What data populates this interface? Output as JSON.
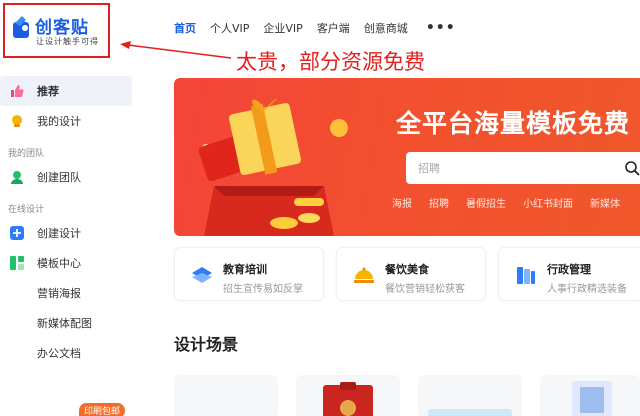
{
  "logo": {
    "name": "创客贴",
    "slogan": "让设计触手可得"
  },
  "annotation": {
    "text": "太贵，部分资源免费"
  },
  "topnav": {
    "items": [
      "首页",
      "个人VIP",
      "企业VIP",
      "客户端",
      "创意商城"
    ],
    "active_index": 0,
    "more": "•••"
  },
  "sidebar": {
    "recommend": "推荐",
    "my_design": "我的设计",
    "team_section": "我的团队",
    "create_team": "创建团队",
    "online_section": "在线设计",
    "create_design": "创建设计",
    "template_center": "模板中心",
    "sub_items": [
      "营销海报",
      "新媒体配图",
      "办公文档"
    ],
    "print_badge": "印刷包邮"
  },
  "banner": {
    "title": "全平台海量模板免费",
    "search_placeholder": "招聘",
    "tags": [
      "海报",
      "招聘",
      "暑假招生",
      "小红书封面",
      "新媒体"
    ]
  },
  "categories": [
    {
      "title": "教育培训",
      "subtitle": "招生宣传易如反掌",
      "icon": "education-icon",
      "color": "#2e7cf6"
    },
    {
      "title": "餐饮美食",
      "subtitle": "餐饮营销轻松获客",
      "icon": "food-icon",
      "color": "#f5b400"
    },
    {
      "title": "行政管理",
      "subtitle": "人事行政精选装备",
      "icon": "admin-icon",
      "color": "#2e7cf6"
    }
  ],
  "section": {
    "title": "设计场景"
  },
  "colors": {
    "brand": "#1a5fe0",
    "banner": "#f24f2e",
    "annotation": "#e32020",
    "badge": "#f26d2a"
  }
}
